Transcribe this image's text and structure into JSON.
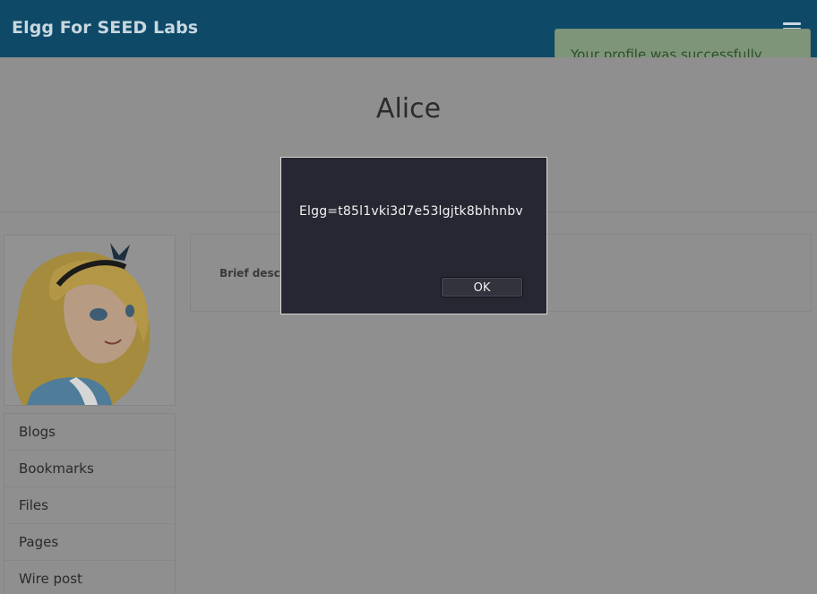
{
  "header": {
    "site_title": "Elgg For SEED Labs",
    "menu_icon": "hamburger-menu-icon"
  },
  "toast": {
    "message": "Your profile was successfully saved."
  },
  "profile": {
    "name": "Alice",
    "brief_description_label": "Brief descri"
  },
  "sidebar": {
    "items": [
      {
        "label": "Blogs"
      },
      {
        "label": "Bookmarks"
      },
      {
        "label": "Files"
      },
      {
        "label": "Pages"
      },
      {
        "label": "Wire post"
      }
    ]
  },
  "dialog": {
    "message": "Elgg=t85l1vki3d7e53lgjtk8bhhnbv",
    "ok_label": "OK"
  }
}
